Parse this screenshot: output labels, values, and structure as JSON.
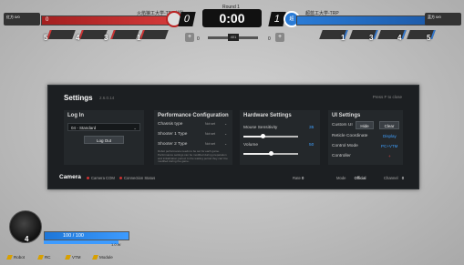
{
  "top_hud": {
    "red_team_name": "火焰狼工大学-TRO战队",
    "blue_team_name": "超蓝工大学-TRP",
    "round": "Round 1",
    "timer": "0:00",
    "score_red": "0",
    "score_blue": "1",
    "red_hp_value": "0",
    "blue_hp_value": "0",
    "red_corner_text": "红方 0/0",
    "blue_corner_text": "蓝方 0/0",
    "blue_emblem": "超",
    "center_chip": "401",
    "red_robots": [
      {
        "num": "5"
      },
      {
        "num": "4"
      },
      {
        "num": "3"
      },
      {
        "num": "1"
      }
    ],
    "blue_robots": [
      {
        "num": "1"
      },
      {
        "num": "3"
      },
      {
        "num": "4"
      },
      {
        "num": "5"
      }
    ],
    "left_mini": {
      "icon": "+",
      "value": "0"
    },
    "right_mini": {
      "icon": "+",
      "value": "0"
    }
  },
  "settings": {
    "title": "Settings",
    "version": "2.6.0.14",
    "close_hint": "Press F to close",
    "login": {
      "title": "Log In",
      "selected_account": "04 - Standard",
      "logout_label": "Log Out"
    },
    "performance": {
      "title": "Performance Configuration",
      "rows": [
        {
          "label": "Chassis type",
          "value": "Not set"
        },
        {
          "label": "Shooter 1 Type",
          "value": "Not set"
        },
        {
          "label": "Shooter 2 Type",
          "value": "Not set"
        }
      ],
      "note": "Robot performance needs to be set for each game. Performance settings can be modified during preparation and initialization period. In the waiting period they can't be modified during the game."
    },
    "hardware": {
      "title": "Hardware Settings",
      "mouse_label": "Mouse Sensitivity",
      "mouse_value": "35",
      "mouse_level": 0.35,
      "volume_label": "Volume",
      "volume_value": "50",
      "volume_level": 0.5
    },
    "ui": {
      "title": "UI Settings",
      "custom_ui_label": "Custom UI",
      "hide_label": "Hide",
      "clear_label": "Clear",
      "reticle_label": "Reticle Coordinate",
      "reticle_value": "Display",
      "control_label": "Control Mode",
      "control_value": "PC+VTM",
      "controller_label": "Controller",
      "controller_value": "+"
    },
    "footer": {
      "title": "Camera",
      "camera_com": "Camera COM",
      "connection_status": "Connection Status",
      "rate_label": "Rate",
      "rate_value": "0",
      "mode_label": "Mode",
      "mode_value": "Official",
      "channel_label": "Channel",
      "channel_value": "0"
    }
  },
  "bottom_hud": {
    "robot_number": "4",
    "hp_text": "100 / 100",
    "hp_level": 1.0,
    "sub_label": "1.0 W",
    "status_items": [
      "Robot",
      "RC",
      "VTM",
      "Module"
    ]
  }
}
